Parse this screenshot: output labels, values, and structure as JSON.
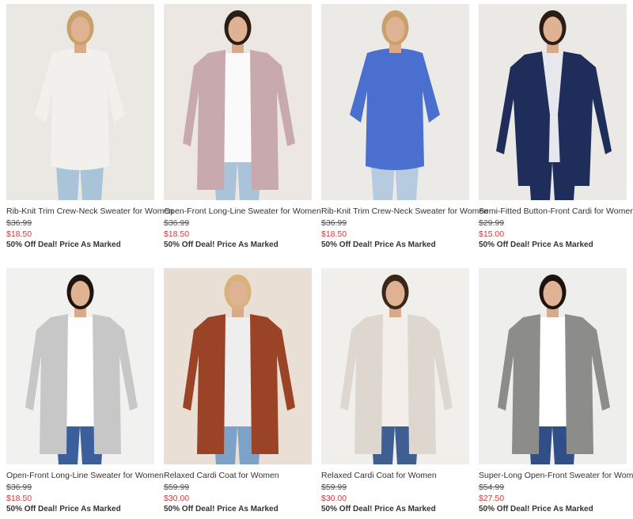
{
  "products": [
    {
      "title": "Rib-Knit Trim Crew-Neck Sweater for Women",
      "original_price": "$36.99",
      "sale_price": "$18.50",
      "promo": "50% Off Deal! Price As Marked",
      "bg": "#eae8e3",
      "garment": "#f2f0ec",
      "inner": "#f2f0ec",
      "style": "pullover",
      "pants": "#a9c3d9",
      "hair": "#c9a06a"
    },
    {
      "title": "Open-Front Long-Line Sweater for Women",
      "original_price": "$36.99",
      "sale_price": "$18.50",
      "promo": "50% Off Deal! Price As Marked",
      "bg": "#ece7e2",
      "garment": "#c8a9ad",
      "inner": "#fafafa",
      "style": "cardigan",
      "pants": "#a9c3d9",
      "hair": "#2b1d16"
    },
    {
      "title": "Rib-Knit Trim Crew-Neck Sweater for Women",
      "original_price": "$36.99",
      "sale_price": "$18.50",
      "promo": "50% Off Deal! Price As Marked",
      "bg": "#eceae6",
      "garment": "#4a6fcf",
      "inner": "#4a6fcf",
      "style": "pullover",
      "pants": "#b7cbe0",
      "hair": "#c9a06a"
    },
    {
      "title": "Semi-Fitted Button-Front Cardi for Women",
      "original_price": "$29.99",
      "sale_price": "$15.00",
      "promo": "50% Off Deal! Price As Marked",
      "bg": "#ebe9e5",
      "garment": "#1f2d5a",
      "inner": "#e6e8ee",
      "style": "cardi",
      "pants": "#1f2d5a",
      "hair": "#2b1d16"
    },
    {
      "title": "Open-Front Long-Line Sweater for Women",
      "original_price": "$36.99",
      "sale_price": "$18.50",
      "promo": "50% Off Deal! Price As Marked",
      "bg": "#f1f1f0",
      "garment": "#c7c7c7",
      "inner": "#ffffff",
      "style": "cardigan",
      "pants": "#3a5f9a",
      "hair": "#1e140f"
    },
    {
      "title": "Relaxed Cardi Coat for Women",
      "original_price": "$59.99",
      "sale_price": "$30.00",
      "promo": "50% Off Deal! Price As Marked",
      "bg": "#e9dfd5",
      "garment": "#9b4326",
      "inner": "#eeeeee",
      "style": "cardigan",
      "pants": "#7da2c8",
      "hair": "#d8b27a"
    },
    {
      "title": "Relaxed Cardi Coat for Women",
      "original_price": "$59.99",
      "sale_price": "$30.00",
      "promo": "50% Off Deal! Price As Marked",
      "bg": "#f1efec",
      "garment": "#ddd7cf",
      "inner": "#f4eeea",
      "style": "cardigan",
      "pants": "#3f5f92",
      "hair": "#3a261a"
    },
    {
      "title": "Super-Long Open-Front Sweater for Women",
      "original_price": "$54.99",
      "sale_price": "$27.50",
      "promo": "50% Off Deal! Price As Marked",
      "bg": "#eeeeec",
      "garment": "#8c8c8a",
      "inner": "#ffffff",
      "style": "cardigan",
      "pants": "#2f4f86",
      "hair": "#1e140f"
    }
  ]
}
